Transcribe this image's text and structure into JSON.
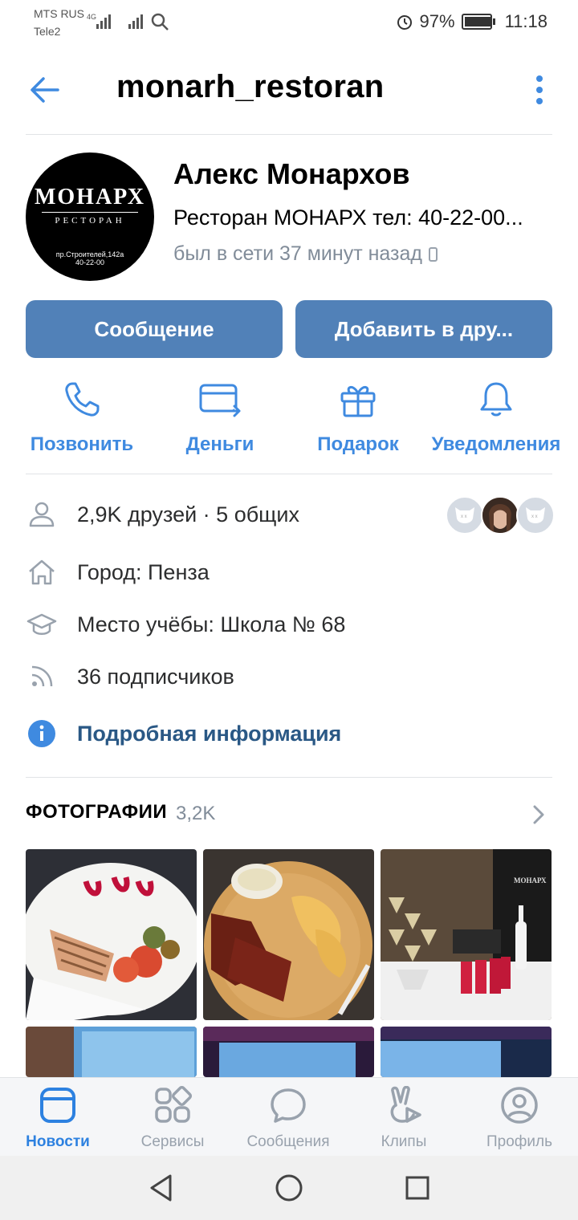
{
  "status_bar": {
    "carrier_1": "MTS RUS",
    "carrier_2": "Tele2",
    "battery": "97%",
    "battery_level": 0.97,
    "time": "11:18"
  },
  "header": {
    "title": "monarh_restoran"
  },
  "profile": {
    "avatar_logo": {
      "brand": "МОНАРХ",
      "subtitle": "РЕСТОРАН",
      "address": "пр.Строителей,142а",
      "phone": "40-22-00"
    },
    "name": "Алекс Монархов",
    "status": "Ресторан МОНАРХ тел: 40-22-00...",
    "last_seen": "был в сети 37 минут назад"
  },
  "buttons": {
    "message": "Сообщение",
    "add_friend": "Добавить в дру..."
  },
  "actions": [
    {
      "label": "Позвонить",
      "icon": "phone-icon"
    },
    {
      "label": "Деньги",
      "icon": "money-transfer-icon"
    },
    {
      "label": "Подарок",
      "icon": "gift-icon"
    },
    {
      "label": "Уведомления",
      "icon": "bell-icon"
    }
  ],
  "info": {
    "friends": "2,9K друзей · 5 общих",
    "city": "Город: Пенза",
    "education": "Место учёбы: Школа № 68",
    "followers": "36 подписчиков",
    "details_link": "Подробная информация"
  },
  "photos": {
    "heading": "ФОТОГРАФИИ",
    "count": "3,2K"
  },
  "tabs": [
    {
      "label": "Новости",
      "icon": "news-icon",
      "active": true
    },
    {
      "label": "Сервисы",
      "icon": "services-icon",
      "active": false
    },
    {
      "label": "Сообщения",
      "icon": "messages-icon",
      "active": false
    },
    {
      "label": "Клипы",
      "icon": "clips-icon",
      "active": false
    },
    {
      "label": "Профиль",
      "icon": "profile-icon",
      "active": false
    }
  ],
  "colors": {
    "accent": "#5181b8",
    "link": "#3f8ae0",
    "active_tab": "#2d81e0",
    "muted": "#818c99"
  }
}
